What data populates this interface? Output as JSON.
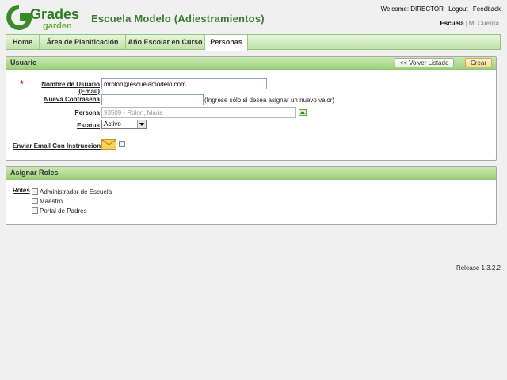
{
  "header": {
    "logo_text_top": "Grades",
    "logo_text_bottom": "garden",
    "school_title": "Escuela Modelo (Adiestramientos)",
    "welcome": "Welcome: DIRECTOR",
    "logout": "Logout",
    "feedback": "Feedback",
    "context_active": "Escuela",
    "context_sep": "|",
    "context_other": "Mi Cuenta"
  },
  "nav": {
    "tabs": [
      {
        "label": "Home"
      },
      {
        "label": "Área de Planificación"
      },
      {
        "label": "Año Escolar en Curso"
      },
      {
        "label": "Personas"
      }
    ]
  },
  "usuario": {
    "title": "Usuario",
    "back_button": "<< Volver Listado",
    "create_button": "Crear",
    "required_mark": "*",
    "username_label": "Nombre de Usuario (Email)",
    "username_value": "mrolon@escuelamodelo.com",
    "password_label": "Nueva Contraseña",
    "password_value": "",
    "password_note": "(Ingrese sólo si desea asignar un nuevo valor)",
    "person_label": "Persona",
    "person_value": "93509 - Rolon, Maria",
    "status_label": "Estatus",
    "status_value": "Activo",
    "email_label": "Enviar Email Con Instrucciones"
  },
  "roles": {
    "title": "Asignar Roles",
    "label": "Roles",
    "items": [
      {
        "label": "Administrador de Escuela"
      },
      {
        "label": "Maestro"
      },
      {
        "label": "Portal de Padres"
      }
    ]
  },
  "footer": {
    "release": "Release 1.3.2.2"
  }
}
